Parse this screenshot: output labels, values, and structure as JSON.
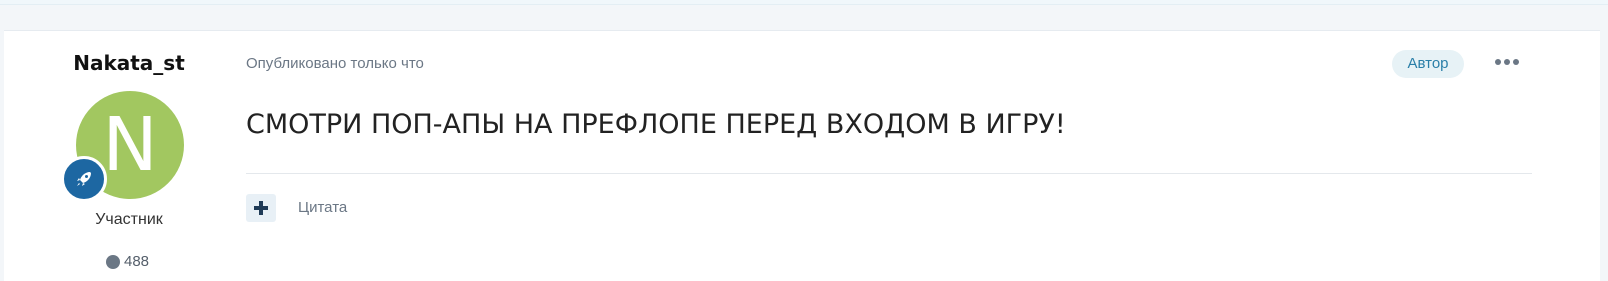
{
  "author": {
    "name": "Nakata_st",
    "avatar_letter": "N",
    "avatar_color": "#a2c760",
    "rank_icon": "rocket-icon",
    "rank_badge_color": "#1d67a2",
    "title": "Участник",
    "post_count": "488"
  },
  "post": {
    "meta": "Опубликовано только что",
    "author_badge": "Автор",
    "more_icon": "ellipsis-icon",
    "content": "СМОТРИ ПОП-АПЫ НА ПРЕФЛОПЕ ПЕРЕД ВХОДОМ В ИГРУ!",
    "quote_icon": "plus-icon",
    "quote_label": "Цитата"
  }
}
